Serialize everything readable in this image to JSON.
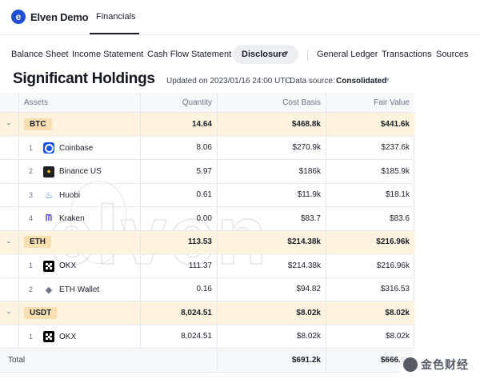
{
  "app": {
    "logo_letter": "e",
    "name": "Elven Demo",
    "top_tab": "Financials"
  },
  "subnav": {
    "items": [
      "Balance Sheet",
      "Income Statement",
      "Cash Flow Statement"
    ],
    "active": "Disclosure",
    "right_items": [
      "General Ledger",
      "Transactions",
      "Sources"
    ]
  },
  "header": {
    "title": "Significant Holdings",
    "updated": "Updated on 2023/01/16 24:00 UTC",
    "data_source_label": "Data source:",
    "data_source_value": "Consolidated"
  },
  "table": {
    "columns": [
      "Assets",
      "Quantity",
      "Cost Basis",
      "Fair Value"
    ],
    "groups": [
      {
        "asset": "BTC",
        "quantity": "14.64",
        "cost_basis": "$468.8k",
        "fair_value": "$441.6k",
        "rows": [
          {
            "index": "1",
            "icon": "coinbase-icon",
            "name": "Coinbase",
            "quantity": "8.06",
            "cost_basis": "$270.9k",
            "fair_value": "$237.6k"
          },
          {
            "index": "2",
            "icon": "binance-icon",
            "name": "Binance US",
            "quantity": "5.97",
            "cost_basis": "$186k",
            "fair_value": "$185.9k"
          },
          {
            "index": "3",
            "icon": "huobi-icon",
            "name": "Huobi",
            "quantity": "0.61",
            "cost_basis": "$11.9k",
            "fair_value": "$18.1k"
          },
          {
            "index": "4",
            "icon": "kraken-icon",
            "name": "Kraken",
            "quantity": "0.00",
            "cost_basis": "$83.7",
            "fair_value": "$83.6"
          }
        ]
      },
      {
        "asset": "ETH",
        "quantity": "113.53",
        "cost_basis": "$214.38k",
        "fair_value": "$216.96k",
        "rows": [
          {
            "index": "1",
            "icon": "okx-icon",
            "name": "OKX",
            "quantity": "111.37",
            "cost_basis": "$214.38k",
            "fair_value": "$216.96k"
          },
          {
            "index": "2",
            "icon": "eth-icon",
            "name": "ETH Wallet",
            "quantity": "0.16",
            "cost_basis": "$94.82",
            "fair_value": "$316.53"
          }
        ]
      },
      {
        "asset": "USDT",
        "quantity": "8,024.51",
        "cost_basis": "$8.02k",
        "fair_value": "$8.02k",
        "rows": [
          {
            "index": "1",
            "icon": "okx-icon",
            "name": "OKX",
            "quantity": "8,024.51",
            "cost_basis": "$8.02k",
            "fair_value": "$8.02k"
          }
        ]
      }
    ],
    "total": {
      "label": "Total",
      "cost_basis": "$691.2k",
      "fair_value": "$666.5k"
    }
  },
  "watermark": {
    "text": "elven"
  },
  "corner_watermark": {
    "text": "金色财经"
  }
}
